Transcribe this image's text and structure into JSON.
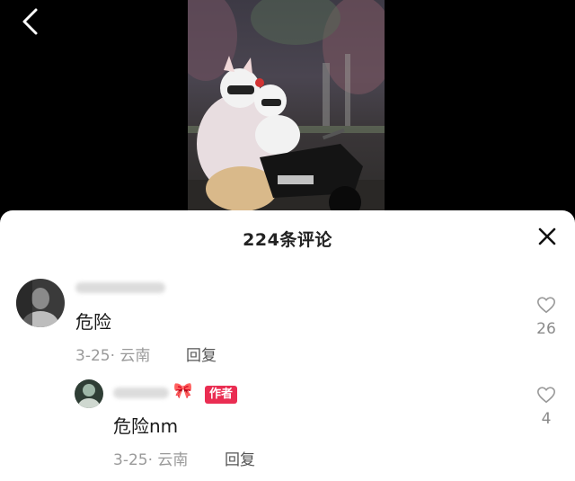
{
  "sheet": {
    "title": "224条评论"
  },
  "comments": [
    {
      "text": "危险",
      "date": "3-25",
      "location": "云南",
      "reply_label": "回复",
      "likes": "26",
      "avatar_icon": "user-avatar"
    },
    {
      "text": "危险nm",
      "date": "3-25",
      "location": "云南",
      "reply_label": "回复",
      "likes": "4",
      "badge": "作者",
      "name_emoji": "🎀",
      "avatar_icon": "user-avatar"
    }
  ],
  "colors": {
    "badge": "#ea2d52",
    "background": "#000000",
    "sheet": "#ffffff"
  },
  "icons": [
    "back-arrow-icon",
    "close-icon",
    "heart-outline-icon"
  ]
}
